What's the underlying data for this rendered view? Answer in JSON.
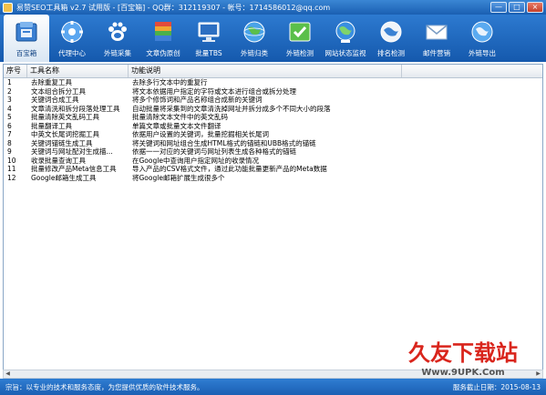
{
  "window": {
    "title": "易赞SEO工具箱 v2.7 试用版 - [百宝箱] - QQ群：312119307 - 帐号：1714586012@qq.com",
    "controls": [
      "—",
      "□",
      "×"
    ]
  },
  "toolbar": {
    "items": [
      {
        "label": "百宝箱",
        "icon": "treasure-box-icon",
        "active": true
      },
      {
        "label": "代理中心",
        "icon": "proxy-gear-icon"
      },
      {
        "label": "外链采集",
        "icon": "baidu-paw-icon"
      },
      {
        "label": "文章伪原创",
        "icon": "books-icon"
      },
      {
        "label": "批量TBS",
        "icon": "monitor-icon"
      },
      {
        "label": "外链归类",
        "icon": "globe-icon"
      },
      {
        "label": "外链检测",
        "icon": "map-check-icon"
      },
      {
        "label": "网站状态监视",
        "icon": "network-globe-icon"
      },
      {
        "label": "排名检测",
        "icon": "ranking-globe-icon"
      },
      {
        "label": "邮件营销",
        "icon": "envelope-icon"
      },
      {
        "label": "外链导出",
        "icon": "export-globe-icon"
      }
    ]
  },
  "table": {
    "columns": [
      "序号",
      "工具名称",
      "功能说明"
    ],
    "rows": [
      [
        "1",
        "去除重复工具",
        "去除多行文本中的重复行"
      ],
      [
        "2",
        "文本组合拆分工具",
        "将文本依据用户指定的字符或文本进行组合或拆分处理"
      ],
      [
        "3",
        "关键词合成工具",
        "将多个修饰词和产品名称组合成新的关键词"
      ],
      [
        "4",
        "文章清洗和拆分段落处理工具",
        "自动批量将采集到的文章清洗掉网址并拆分成多个不同大小的段落"
      ],
      [
        "5",
        "批量清除英文乱码工具",
        "批量清除文本文件中的英文乱码"
      ],
      [
        "6",
        "批量翻译工具",
        "单篇文章或批量文本文件翻译"
      ],
      [
        "7",
        "中英文长尾词挖掘工具",
        "依据用户设置的关键词，批量挖掘相关长尾词"
      ],
      [
        "8",
        "关键词锚链生成工具",
        "将关键词和网址组合生成HTML格式的锚链和UBB格式的锚链"
      ],
      [
        "9",
        "关键词与网址配对生成描...",
        "依据一一对应的关键词与网址列表生成各种格式的锚链"
      ],
      [
        "10",
        "收录批量查询工具",
        "在Google中查询用户指定网址的收录情况"
      ],
      [
        "11",
        "批量修改产品Meta信息工具",
        "导入产品的CSV格式文件，通过此功能批量更新产品的Meta数据"
      ],
      [
        "12",
        "Google邮箱生成工具",
        "将Google邮箱扩展生成很多个"
      ]
    ]
  },
  "statusbar": {
    "left": "宗旨：以专业的技术和服务态度，为您提供优质的软件技术服务。",
    "right": "服务截止日期：2015-08-13"
  },
  "watermark": {
    "title": "久友下载站",
    "url": "Www.9UPK.Com"
  },
  "colors": {
    "toolbar_blue": "#1e66bc",
    "titlebar_blue": "#2c74c8",
    "status_blue": "#2468bd",
    "watermark_red": "#d9251c"
  }
}
